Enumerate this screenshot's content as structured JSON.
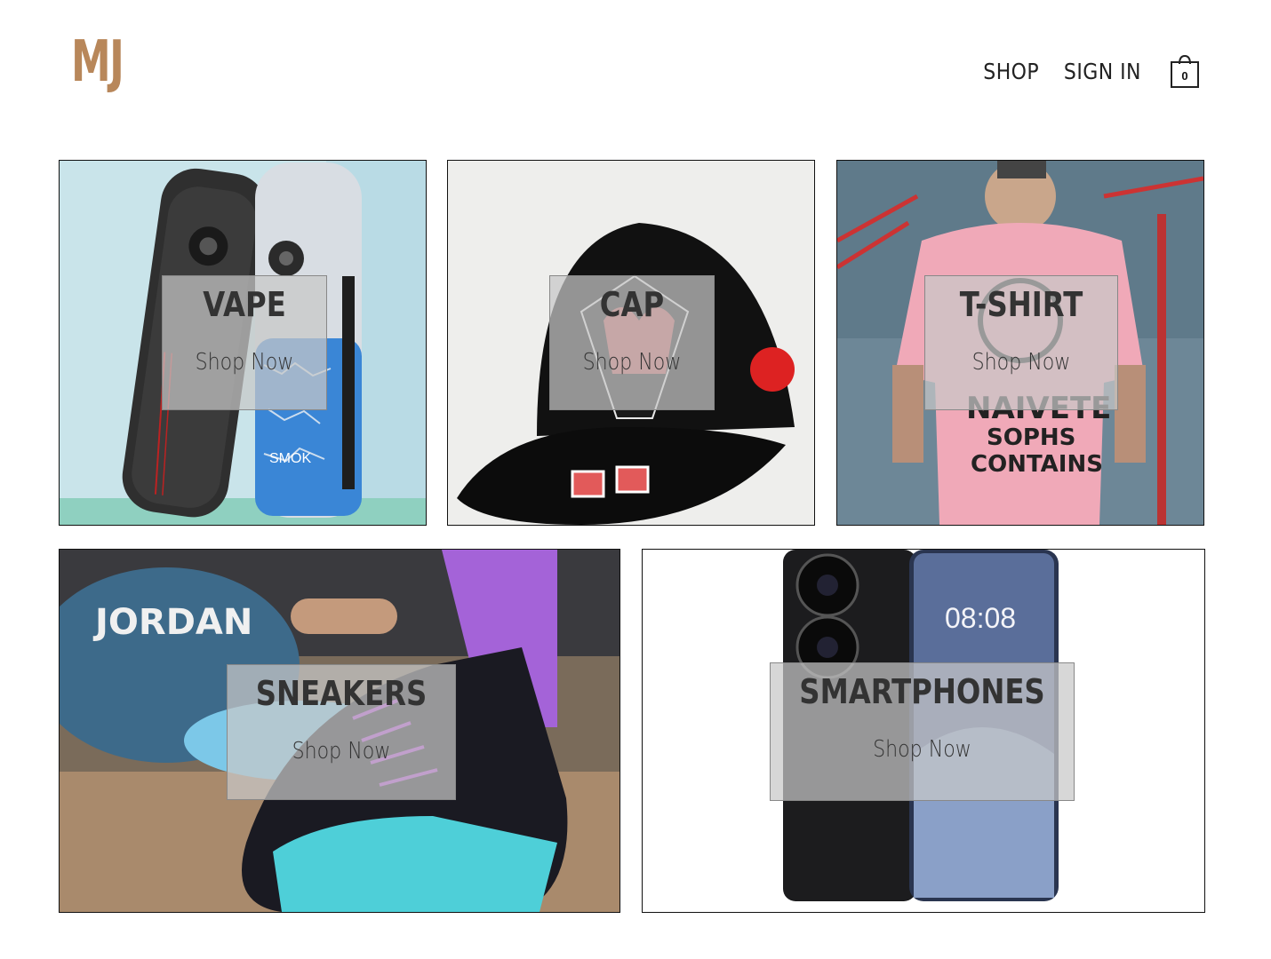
{
  "brand": {
    "logo_text": "MJ",
    "logo_color": "#b8875a"
  },
  "nav": {
    "shop_label": "SHOP",
    "signin_label": "SIGN IN",
    "cart_count": "0",
    "cart_icon": "shopping-bag-icon"
  },
  "categories": [
    {
      "title": "VAPE",
      "cta": "Shop Now"
    },
    {
      "title": "CAP",
      "cta": "Shop Now"
    },
    {
      "title": "T-SHIRT",
      "cta": "Shop Now"
    },
    {
      "title": "SNEAKERS",
      "cta": "Shop Now"
    },
    {
      "title": "SMARTPHONES",
      "cta": "Shop Now"
    }
  ],
  "phone_screen": {
    "time": "08:08"
  },
  "shirt_print": {
    "line1": "NAIVETE",
    "line2": "SOPHS",
    "line3": "CONTAINS"
  },
  "vape_brand": "SMOK",
  "sneaker_ball_text": "JORDAN"
}
